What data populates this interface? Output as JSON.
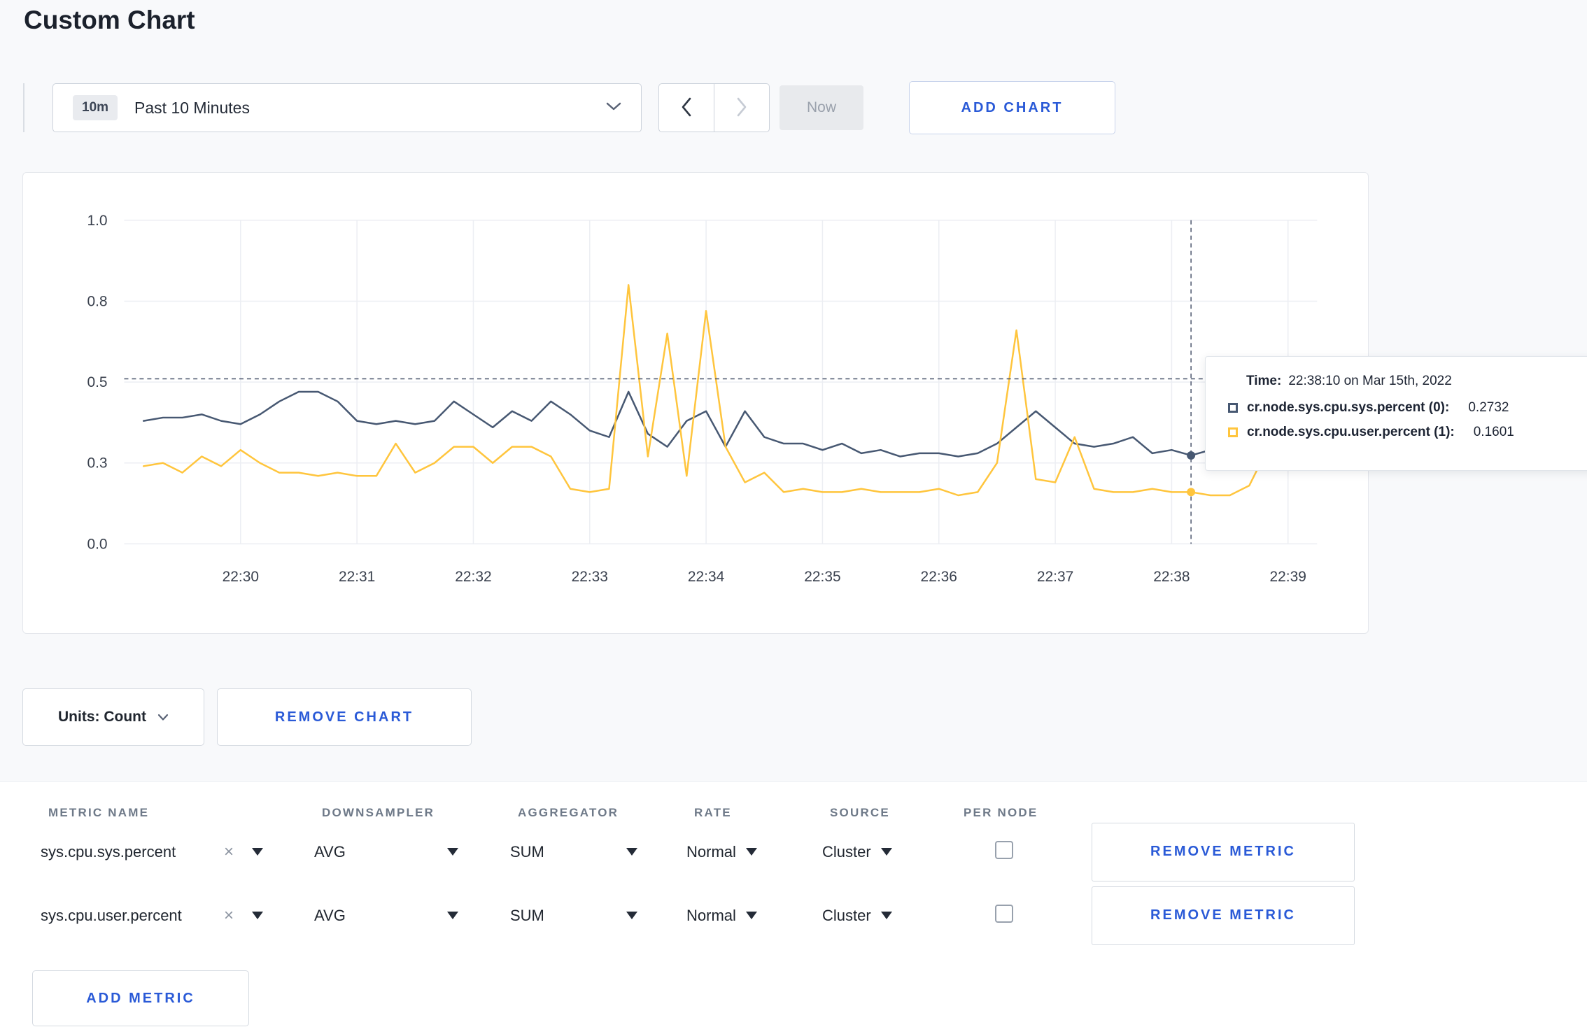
{
  "page": {
    "title": "Custom Chart"
  },
  "toolbar": {
    "time_badge": "10m",
    "time_range_label": "Past 10 Minutes",
    "now_label": "Now",
    "add_chart_label": "ADD CHART"
  },
  "chart_actions": {
    "units_label": "Units: Count",
    "remove_chart_label": "REMOVE CHART"
  },
  "tooltip": {
    "time_label": "Time:",
    "time_value": "22:38:10 on Mar 15th, 2022",
    "series": [
      {
        "label": "cr.node.sys.cpu.sys.percent (0):",
        "value": "0.2732",
        "color": "#475872"
      },
      {
        "label": "cr.node.sys.cpu.user.percent (1):",
        "value": "0.1601",
        "color": "#ffc53d"
      }
    ]
  },
  "metrics": {
    "headers": [
      "METRIC NAME",
      "DOWNSAMPLER",
      "AGGREGATOR",
      "RATE",
      "SOURCE",
      "PER NODE"
    ],
    "clear_symbol": "×",
    "rows": [
      {
        "name": "sys.cpu.sys.percent",
        "downsampler": "AVG",
        "aggregator": "SUM",
        "rate": "Normal",
        "source": "Cluster",
        "remove_label": "REMOVE METRIC"
      },
      {
        "name": "sys.cpu.user.percent",
        "downsampler": "AVG",
        "aggregator": "SUM",
        "rate": "Normal",
        "source": "Cluster",
        "remove_label": "REMOVE METRIC"
      }
    ],
    "add_metric_label": "ADD METRIC"
  },
  "chart_data": {
    "type": "line",
    "ylim": [
      0,
      1.0
    ],
    "t_domain": [
      0,
      615
    ],
    "tick_interval_s": 60,
    "x_tick_labels": [
      "22:30",
      "22:31",
      "22:32",
      "22:33",
      "22:34",
      "22:35",
      "22:36",
      "22:37",
      "22:38",
      "22:39"
    ],
    "y_ticks": [
      {
        "value": 0,
        "label": "0.0"
      },
      {
        "value": 0.25,
        "label": "0.3"
      },
      {
        "value": 0.5,
        "label": "0.5"
      },
      {
        "value": 0.75,
        "label": "0.8"
      },
      {
        "value": 1,
        "label": "1.0"
      }
    ],
    "grid": true,
    "legend_position": "tooltip",
    "series": [
      {
        "name": "cr.node.sys.cpu.sys.percent",
        "color": "#475872",
        "t_start": 10,
        "t_step": 10,
        "values": [
          0.38,
          0.39,
          0.39,
          0.4,
          0.38,
          0.37,
          0.4,
          0.44,
          0.47,
          0.47,
          0.44,
          0.38,
          0.37,
          0.38,
          0.37,
          0.38,
          0.44,
          0.4,
          0.36,
          0.41,
          0.38,
          0.44,
          0.4,
          0.35,
          0.33,
          0.47,
          0.34,
          0.3,
          0.38,
          0.41,
          0.3,
          0.41,
          0.33,
          0.31,
          0.31,
          0.29,
          0.31,
          0.28,
          0.29,
          0.27,
          0.28,
          0.28,
          0.27,
          0.28,
          0.31,
          0.36,
          0.41,
          0.36,
          0.31,
          0.3,
          0.31,
          0.33,
          0.28,
          0.29,
          0.2732,
          0.29,
          0.31
        ]
      },
      {
        "name": "cr.node.sys.cpu.user.percent",
        "color": "#ffc53d",
        "t_start": 10,
        "t_step": 10,
        "values": [
          0.24,
          0.25,
          0.22,
          0.27,
          0.24,
          0.29,
          0.25,
          0.22,
          0.22,
          0.21,
          0.22,
          0.21,
          0.21,
          0.31,
          0.22,
          0.25,
          0.3,
          0.3,
          0.25,
          0.3,
          0.3,
          0.27,
          0.17,
          0.16,
          0.17,
          0.8,
          0.27,
          0.65,
          0.21,
          0.72,
          0.3,
          0.19,
          0.22,
          0.16,
          0.17,
          0.16,
          0.16,
          0.17,
          0.16,
          0.16,
          0.16,
          0.17,
          0.15,
          0.16,
          0.25,
          0.66,
          0.2,
          0.19,
          0.33,
          0.17,
          0.16,
          0.16,
          0.17,
          0.16,
          0.1601,
          0.15,
          0.15,
          0.18,
          0.3,
          0.25
        ]
      }
    ],
    "crosshair": {
      "t": 550,
      "h_value": 0.51,
      "time_label": "22:38:10 on Mar 15th, 2022"
    }
  }
}
